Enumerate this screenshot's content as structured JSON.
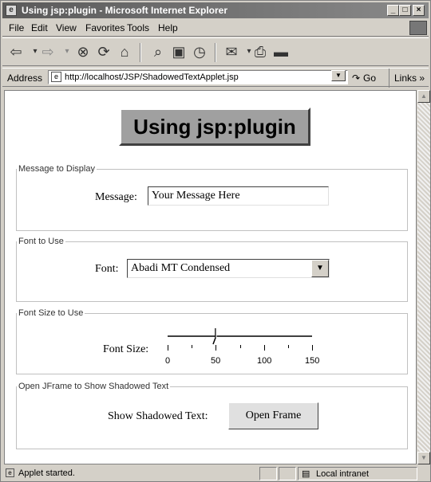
{
  "window": {
    "title": "Using jsp:plugin - Microsoft Internet Explorer"
  },
  "menu": [
    "File",
    "Edit",
    "View",
    "Favorites",
    "Tools",
    "Help"
  ],
  "address": {
    "label": "Address",
    "url": "http://localhost/JSP/ShadowedTextApplet.jsp",
    "go": "Go",
    "links": "Links »"
  },
  "page": {
    "heading": "Using jsp:plugin",
    "message_group": {
      "legend": "Message to Display",
      "label": "Message:",
      "value": "Your Message Here"
    },
    "font_group": {
      "legend": "Font to Use",
      "label": "Font:",
      "value": "Abadi MT Condensed"
    },
    "size_group": {
      "legend": "Font Size to Use",
      "label": "Font Size:",
      "ticks": [
        "0",
        "50",
        "100",
        "150"
      ],
      "min": 0,
      "max": 150,
      "value": 50
    },
    "frame_group": {
      "legend": "Open JFrame to Show Shadowed Text",
      "label": "Show Shadowed Text:",
      "button": "Open Frame"
    }
  },
  "status": {
    "text": "Applet started.",
    "zone": "Local intranet"
  }
}
